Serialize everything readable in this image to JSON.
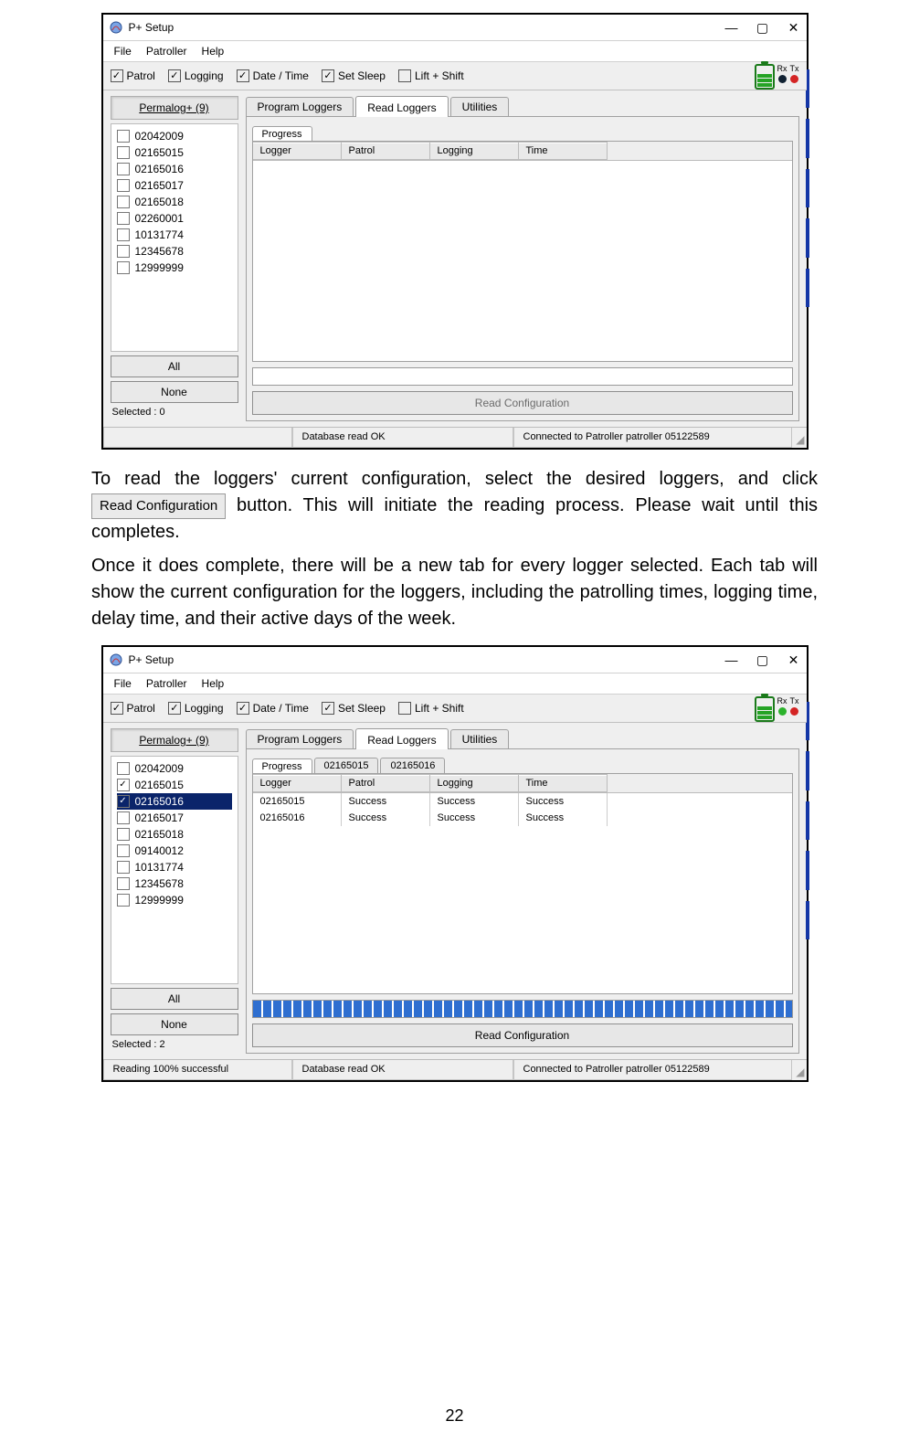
{
  "page_number": "22",
  "screenshotA": {
    "title": "P+ Setup",
    "menus": [
      "File",
      "Patroller",
      "Help"
    ],
    "toolbar": {
      "patrol": {
        "label": "Patrol",
        "checked": true
      },
      "logging": {
        "label": "Logging",
        "checked": true
      },
      "datetime": {
        "label": "Date / Time",
        "checked": true
      },
      "setsleep": {
        "label": "Set Sleep",
        "checked": true
      },
      "liftshift": {
        "label": "Lift + Shift",
        "checked": false
      },
      "rx": "Rx",
      "tx": "Tx"
    },
    "left": {
      "perma": "Permalog+ (9)",
      "items": [
        {
          "id": "02042009",
          "checked": false,
          "sel": false
        },
        {
          "id": "02165015",
          "checked": false,
          "sel": false
        },
        {
          "id": "02165016",
          "checked": false,
          "sel": false
        },
        {
          "id": "02165017",
          "checked": false,
          "sel": false
        },
        {
          "id": "02165018",
          "checked": false,
          "sel": false
        },
        {
          "id": "02260001",
          "checked": false,
          "sel": false
        },
        {
          "id": "10131774",
          "checked": false,
          "sel": false
        },
        {
          "id": "12345678",
          "checked": false,
          "sel": false
        },
        {
          "id": "12999999",
          "checked": false,
          "sel": false
        }
      ],
      "all": "All",
      "none": "None",
      "selected": "Selected : 0"
    },
    "tabs": {
      "t1": "Program Loggers",
      "t2": "Read Loggers",
      "t3": "Utilities"
    },
    "inner": {
      "progress": "Progress"
    },
    "grid": {
      "h1": "Logger",
      "h2": "Patrol",
      "h3": "Logging",
      "h4": "Time"
    },
    "readcfg": "Read Configuration",
    "status": {
      "c1": "",
      "c2": "Database read OK",
      "c3": "Connected to Patroller patroller 05122589"
    }
  },
  "para1_a": "To read the loggers' current configuration, select the desired loggers, and click",
  "para1_btn": "Read Configuration",
  "para1_b": "button. This will initiate the reading process. Please wait until this completes.",
  "para2": "Once it does complete, there will be a new tab for every logger selected. Each tab will show the current configuration for the loggers, including the patrolling times, logging time, delay time, and their active days of the week.",
  "screenshotB": {
    "title": "P+ Setup",
    "menus": [
      "File",
      "Patroller",
      "Help"
    ],
    "toolbar": {
      "patrol": {
        "label": "Patrol",
        "checked": true
      },
      "logging": {
        "label": "Logging",
        "checked": true
      },
      "datetime": {
        "label": "Date / Time",
        "checked": true
      },
      "setsleep": {
        "label": "Set Sleep",
        "checked": true
      },
      "liftshift": {
        "label": "Lift + Shift",
        "checked": false
      },
      "rx": "Rx",
      "tx": "Tx"
    },
    "left": {
      "perma": "Permalog+ (9)",
      "items": [
        {
          "id": "02042009",
          "checked": false,
          "sel": false
        },
        {
          "id": "02165015",
          "checked": true,
          "sel": false
        },
        {
          "id": "02165016",
          "checked": true,
          "sel": true
        },
        {
          "id": "02165017",
          "checked": false,
          "sel": false
        },
        {
          "id": "02165018",
          "checked": false,
          "sel": false
        },
        {
          "id": "09140012",
          "checked": false,
          "sel": false
        },
        {
          "id": "10131774",
          "checked": false,
          "sel": false
        },
        {
          "id": "12345678",
          "checked": false,
          "sel": false
        },
        {
          "id": "12999999",
          "checked": false,
          "sel": false
        }
      ],
      "all": "All",
      "none": "None",
      "selected": "Selected : 2"
    },
    "tabs": {
      "t1": "Program Loggers",
      "t2": "Read Loggers",
      "t3": "Utilities"
    },
    "inner": {
      "progress": "Progress",
      "t_a": "02165015",
      "t_b": "02165016"
    },
    "grid": {
      "h1": "Logger",
      "h2": "Patrol",
      "h3": "Logging",
      "h4": "Time",
      "rows": [
        {
          "c1": "02165015",
          "c2": "Success",
          "c3": "Success",
          "c4": "Success"
        },
        {
          "c1": "02165016",
          "c2": "Success",
          "c3": "Success",
          "c4": "Success"
        }
      ]
    },
    "readcfg": "Read Configuration",
    "status": {
      "c1": "Reading 100% successful",
      "c2": "Database read OK",
      "c3": "Connected to Patroller patroller 05122589"
    }
  }
}
